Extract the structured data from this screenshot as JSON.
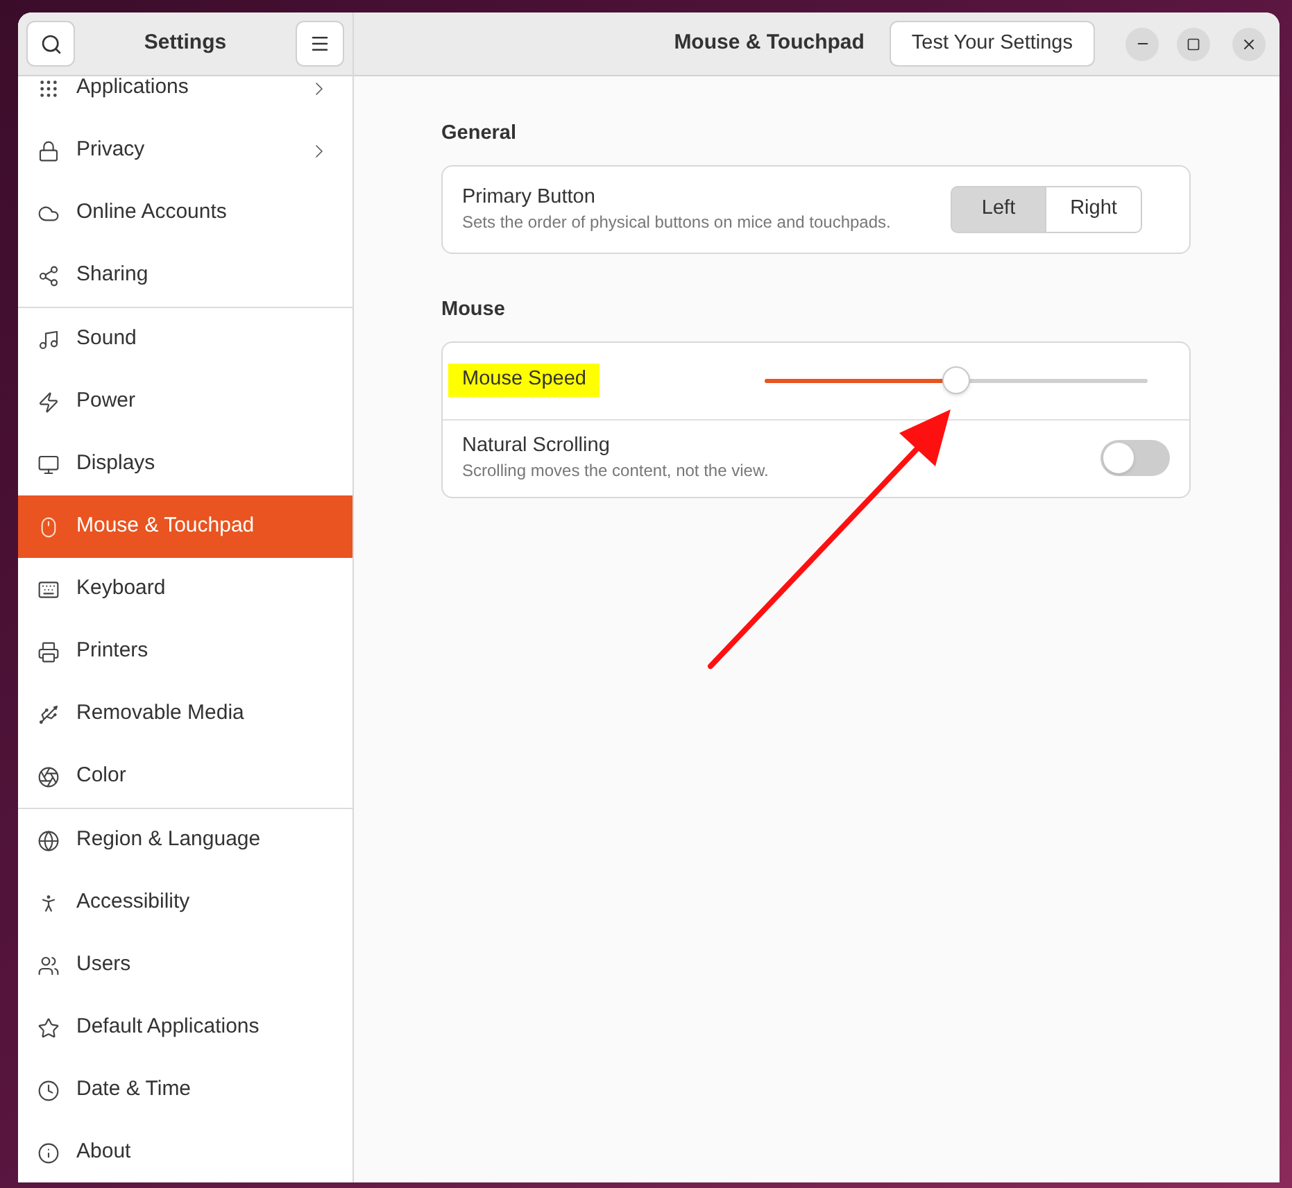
{
  "sidebar": {
    "title": "Settings",
    "groups": [
      {
        "items": [
          {
            "label": "Applications",
            "selected": false,
            "chevron": true
          },
          {
            "label": "Privacy",
            "selected": false,
            "chevron": true
          },
          {
            "label": "Online Accounts",
            "selected": false,
            "chevron": false
          },
          {
            "label": "Sharing",
            "selected": false,
            "chevron": false
          }
        ]
      },
      {
        "items": [
          {
            "label": "Sound",
            "selected": false,
            "chevron": false
          },
          {
            "label": "Power",
            "selected": false,
            "chevron": false
          },
          {
            "label": "Displays",
            "selected": false,
            "chevron": false
          },
          {
            "label": "Mouse & Touchpad",
            "selected": true,
            "chevron": false
          },
          {
            "label": "Keyboard",
            "selected": false,
            "chevron": false
          },
          {
            "label": "Printers",
            "selected": false,
            "chevron": false
          },
          {
            "label": "Removable Media",
            "selected": false,
            "chevron": false
          },
          {
            "label": "Color",
            "selected": false,
            "chevron": false
          }
        ]
      },
      {
        "items": [
          {
            "label": "Region & Language",
            "selected": false,
            "chevron": false
          },
          {
            "label": "Accessibility",
            "selected": false,
            "chevron": false
          },
          {
            "label": "Users",
            "selected": false,
            "chevron": false
          },
          {
            "label": "Default Applications",
            "selected": false,
            "chevron": false
          },
          {
            "label": "Date & Time",
            "selected": false,
            "chevron": false
          },
          {
            "label": "About",
            "selected": false,
            "chevron": false
          }
        ]
      }
    ]
  },
  "header": {
    "title": "Mouse & Touchpad",
    "test_button": "Test Your Settings"
  },
  "sections": [
    {
      "title": "General",
      "rows": [
        {
          "kind": "segmented",
          "label": "Primary Button",
          "description": "Sets the order of physical buttons on mice and touchpads.",
          "options": [
            {
              "label": "Left",
              "selected": true
            },
            {
              "label": "Right",
              "selected": false
            }
          ]
        }
      ]
    },
    {
      "title": "Mouse",
      "rows": [
        {
          "kind": "slider",
          "label": "Mouse Speed",
          "highlighted": true,
          "level": 0.5
        },
        {
          "kind": "switch",
          "label": "Natural Scrolling",
          "description": "Scrolling moves the content, not the view.",
          "on": false
        }
      ]
    }
  ]
}
